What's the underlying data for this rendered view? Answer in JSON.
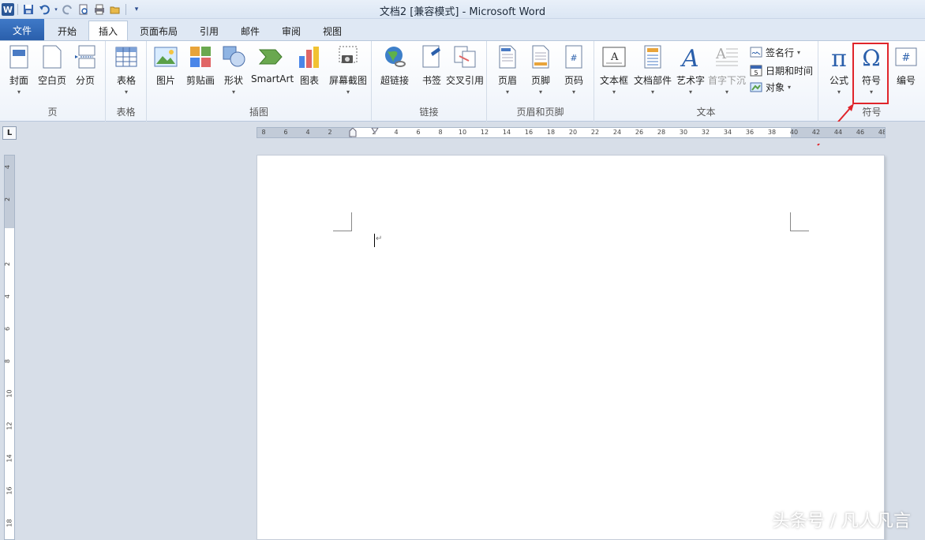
{
  "window": {
    "title": "文档2 [兼容模式] - Microsoft Word"
  },
  "quick_access": {
    "word_logo": "W",
    "items": [
      "save-icon",
      "undo-icon",
      "redo-icon",
      "print-preview-icon",
      "print-icon",
      "open-folder-icon",
      "customize-dropdown-icon"
    ]
  },
  "tabs": [
    "文件",
    "开始",
    "插入",
    "页面布局",
    "引用",
    "邮件",
    "审阅",
    "视图"
  ],
  "active_tab": "插入",
  "ribbon": {
    "groups": {
      "page": "页",
      "table": "表格",
      "illustrations": "插图",
      "links": "链接",
      "header_footer": "页眉和页脚",
      "text": "文本",
      "symbols": "符号"
    },
    "buttons": {
      "cover": "封面",
      "blank_page": "空白页",
      "page_break": "分页",
      "table": "表格",
      "picture": "图片",
      "clipart": "剪贴画",
      "shapes": "形状",
      "smartart": "SmartArt",
      "chart": "图表",
      "screenshot": "屏幕截图",
      "hyperlink": "超链接",
      "bookmark": "书签",
      "cross_ref": "交叉引用",
      "header": "页眉",
      "footer": "页脚",
      "page_number": "页码",
      "textbox": "文本框",
      "quick_parts": "文档部件",
      "wordart": "艺术字",
      "dropcap": "首字下沉",
      "signature_line": "签名行",
      "date_time": "日期和时间",
      "object": "对象",
      "equation": "公式",
      "symbol": "符号",
      "numbering": "编号"
    }
  },
  "ruler": {
    "horizontal_numbers": [
      "8",
      "6",
      "4",
      "2",
      "",
      "2",
      "4",
      "6",
      "8",
      "10",
      "12",
      "14",
      "16",
      "18",
      "20",
      "22",
      "24",
      "26",
      "28",
      "30",
      "32",
      "34",
      "36",
      "38",
      "40",
      "42",
      "44",
      "46",
      "48"
    ],
    "vertical_numbers": [
      "4",
      "2",
      "",
      "2",
      "4",
      "6",
      "8",
      "10",
      "12",
      "14",
      "16",
      "18"
    ],
    "tab_selector": "L"
  },
  "document": {
    "paragraph_mark": "↵"
  },
  "watermark": "头条号 / 凡人凡言",
  "colors": {
    "highlight": "#e0252b",
    "file_tab": "#2a5fab"
  }
}
